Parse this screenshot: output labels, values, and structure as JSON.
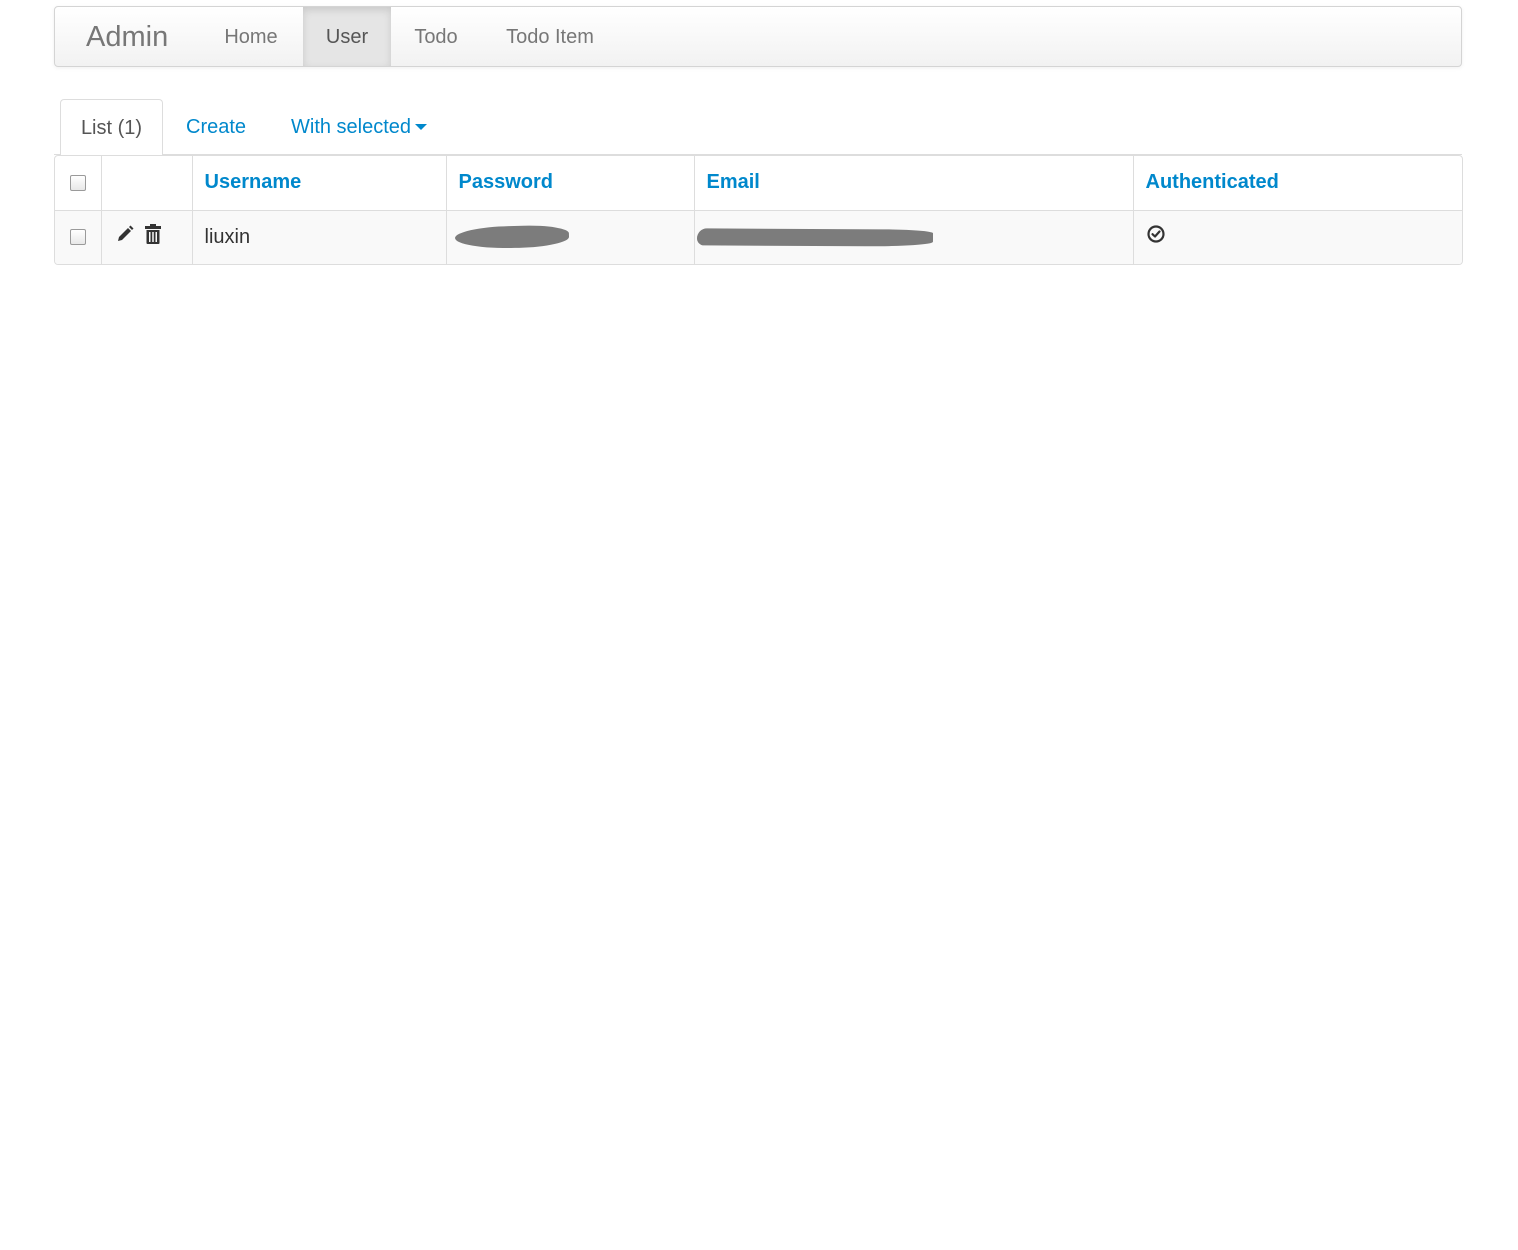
{
  "navbar": {
    "brand": "Admin",
    "items": [
      {
        "label": "Home",
        "active": false
      },
      {
        "label": "User",
        "active": true
      },
      {
        "label": "Todo",
        "active": false
      },
      {
        "label": "Todo Item",
        "active": false
      }
    ]
  },
  "tabs": {
    "list": "List (1)",
    "create": "Create",
    "with_selected": "With selected"
  },
  "table": {
    "columns": [
      "Username",
      "Password",
      "Email",
      "Authenticated"
    ],
    "rows": [
      {
        "username": "liuxin",
        "authenticated_icon": "check-circle-icon"
      }
    ]
  },
  "colors": {
    "link": "#0088cc",
    "nav_active_bg": "#e5e5e5",
    "row_stripe": "#f9f9f9",
    "border": "#dddddd"
  },
  "icons": [
    "pencil-icon",
    "trash-icon",
    "check-circle-icon",
    "caret-down-icon"
  ]
}
